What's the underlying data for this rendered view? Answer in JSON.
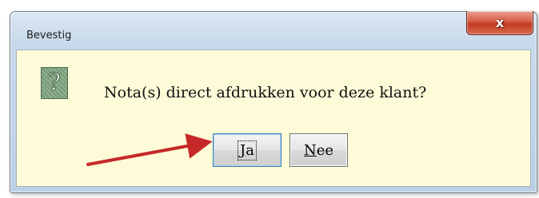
{
  "window": {
    "title": "Bevestig",
    "close_symbol": "x"
  },
  "dialog": {
    "icon": "question-icon",
    "icon_glyph": "?",
    "message": "Nota(s) direct afdrukken voor deze klant?"
  },
  "buttons": {
    "yes": {
      "mnemonic": "J",
      "rest": "a"
    },
    "no": {
      "mnemonic": "N",
      "rest": "ee"
    }
  },
  "annotation": {
    "arrow_color": "#c62828"
  }
}
